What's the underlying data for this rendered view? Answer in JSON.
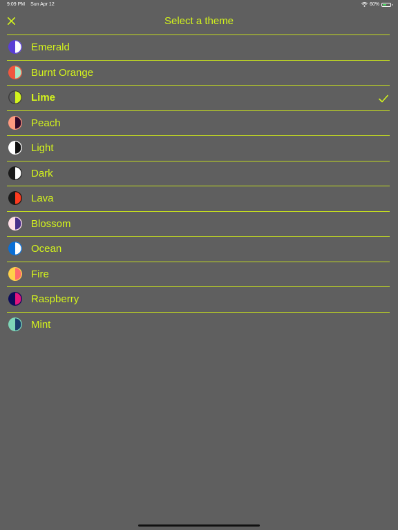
{
  "status_bar": {
    "time": "9:09 PM",
    "date": "Sun Apr 12",
    "battery": "60%",
    "battery_level": 0.6
  },
  "header": {
    "title": "Select a theme",
    "close_icon": "close-x-icon"
  },
  "colors": {
    "background": "#5f5f5f",
    "accent": "#d4f41c"
  },
  "themes": [
    {
      "label": "Emerald",
      "left": "#5a3ed6",
      "right": "#ffffff",
      "border": "#5a3ed6",
      "selected": false
    },
    {
      "label": "Burnt Orange",
      "left": "#f0573f",
      "right": "#a7e8c8",
      "border": "#f0573f",
      "selected": false
    },
    {
      "label": "Lime",
      "left": "#5f5f5f",
      "right": "#d4f41c",
      "border": "#3a3a3a",
      "selected": true
    },
    {
      "label": "Peach",
      "left": "#ff9a80",
      "right": "#30082a",
      "border": "#ff9a80",
      "selected": false
    },
    {
      "label": "Light",
      "left": "#ffffff",
      "right": "#111111",
      "border": "#ffffff",
      "selected": false
    },
    {
      "label": "Dark",
      "left": "#1a1a1a",
      "right": "#ffffff",
      "border": "#1a1a1a",
      "selected": false
    },
    {
      "label": "Lava",
      "left": "#1a1a1a",
      "right": "#ff3b1f",
      "border": "#1a1a1a",
      "selected": false
    },
    {
      "label": "Blossom",
      "left": "#ffdfe8",
      "right": "#4a2f8a",
      "border": "#ffdfe8",
      "selected": false
    },
    {
      "label": "Ocean",
      "left": "#0a6fd6",
      "right": "#ffffff",
      "border": "#0a6fd6",
      "selected": false
    },
    {
      "label": "Fire",
      "left": "#ffd04a",
      "right": "#ff6b6b",
      "border": "#ffd04a",
      "selected": false
    },
    {
      "label": "Raspberry",
      "left": "#0d0d5a",
      "right": "#e3157e",
      "border": "#0d0d5a",
      "selected": false
    },
    {
      "label": "Mint",
      "left": "#7ed6b8",
      "right": "#1a3e6b",
      "border": "#7ed6b8",
      "selected": false
    }
  ]
}
